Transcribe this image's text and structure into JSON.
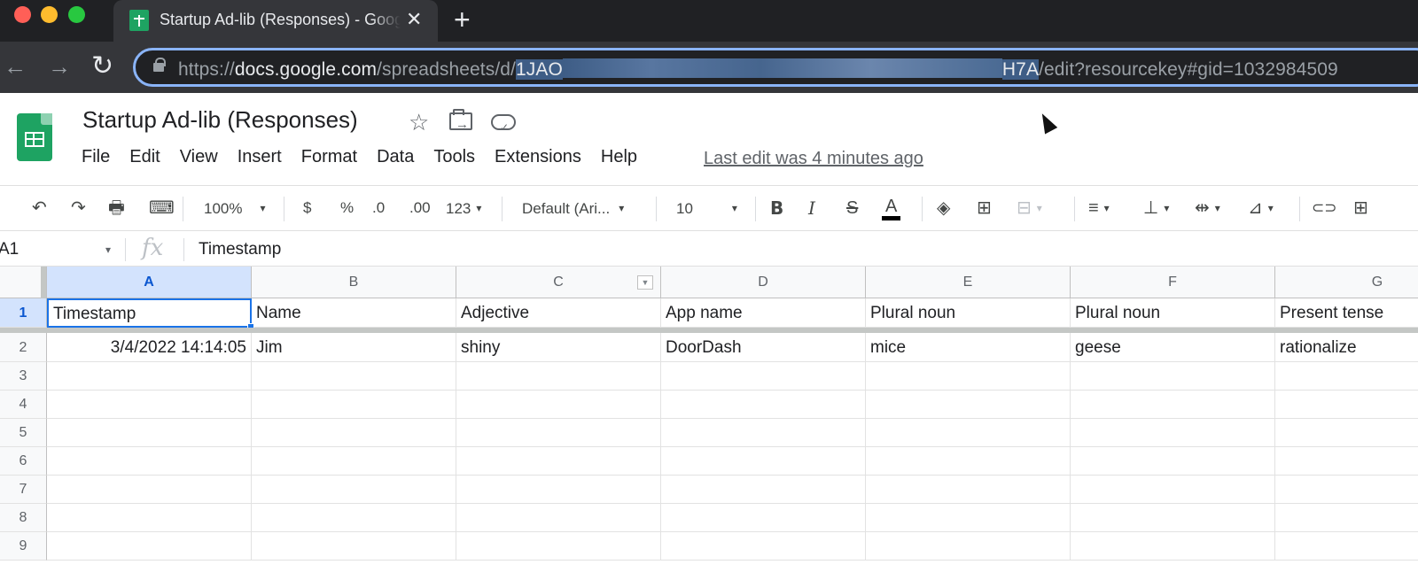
{
  "browser": {
    "tab_title": "Startup Ad-lib (Responses) - Google Sheets",
    "close_glyph": "✕",
    "new_tab_glyph": "+",
    "url_prefix": "https://",
    "url_host": "docs.google.com",
    "url_path": "/spreadsheets/d/",
    "url_sel_start": "1JAO",
    "url_sel_end": "H7A",
    "url_tail": "/edit?resourcekey#gid=1032984509",
    "back_glyph": "←",
    "forward_glyph": "→",
    "reload_glyph": "↻"
  },
  "doc": {
    "title": "Startup Ad-lib (Responses)",
    "star_glyph": "☆",
    "menus": [
      "File",
      "Edit",
      "View",
      "Insert",
      "Format",
      "Data",
      "Tools",
      "Extensions",
      "Help"
    ],
    "last_edit": "Last edit was 4 minutes ago"
  },
  "toolbar": {
    "undo": "↶",
    "redo": "↷",
    "print": "🖶",
    "paint_format": "⌨",
    "zoom": "100%",
    "currency": "$",
    "percent": "%",
    "dec_decrease": ".0",
    "dec_increase": ".00",
    "more_formats": "123",
    "font": "Default (Ari...",
    "font_size": "10",
    "bold": "B",
    "italic": "I",
    "strike": "S",
    "text_color": "A",
    "fill": "◈",
    "borders": "⊞",
    "merge": "⊟",
    "halign": "≡",
    "valign": "⊥",
    "wrap": "⇹",
    "rotate": "⊿",
    "link": "⊂⊃",
    "comment": "⊞",
    "caret": "▾"
  },
  "formula_bar": {
    "name_box": "A1",
    "fx": "fx",
    "value": "Timestamp"
  },
  "grid": {
    "columns": [
      "A",
      "B",
      "C",
      "D",
      "E",
      "F",
      "G"
    ],
    "rows": [
      "1",
      "2",
      "3",
      "4",
      "5",
      "6",
      "7",
      "8",
      "9"
    ],
    "header_row": [
      "Timestamp",
      "Name",
      "Adjective",
      "App name",
      "Plural noun",
      "Plural noun",
      "Present tense"
    ],
    "data_row": [
      "3/4/2022 14:14:05",
      "Jim",
      "shiny",
      "DoorDash",
      "mice",
      "geese",
      "rationalize"
    ],
    "selected_cell": "A1",
    "selection_color": "#1a73e8"
  }
}
